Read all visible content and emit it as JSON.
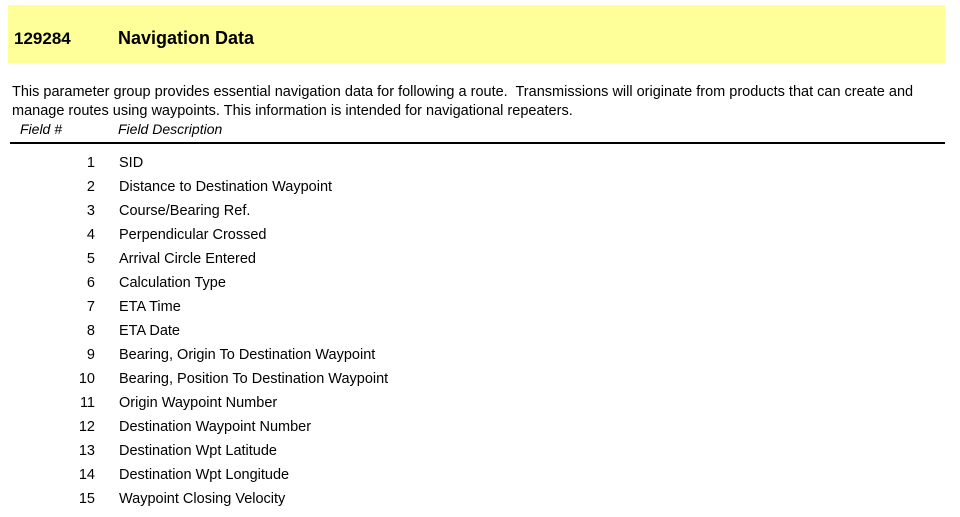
{
  "document": {
    "banner": {
      "pgn_number": "129284",
      "title": "Navigation Data",
      "background_color": "#ffff99"
    },
    "description": "This parameter group provides essential navigation data for following a route.  Transmissions will originate from products that can create and manage routes using waypoints. This information is intended for navigational repeaters.",
    "table": {
      "headers": {
        "number": "Field #",
        "description": "Field Description"
      },
      "rows": [
        {
          "num": "1",
          "desc": "SID"
        },
        {
          "num": "2",
          "desc": "Distance to Destination Waypoint"
        },
        {
          "num": "3",
          "desc": "Course/Bearing Ref."
        },
        {
          "num": "4",
          "desc": "Perpendicular Crossed"
        },
        {
          "num": "5",
          "desc": "Arrival Circle Entered"
        },
        {
          "num": "6",
          "desc": "Calculation Type"
        },
        {
          "num": "7",
          "desc": "ETA Time"
        },
        {
          "num": "8",
          "desc": "ETA Date"
        },
        {
          "num": "9",
          "desc": "Bearing, Origin To Destination Waypoint"
        },
        {
          "num": "10",
          "desc": "Bearing, Position To Destination Waypoint"
        },
        {
          "num": "11",
          "desc": "Origin Waypoint Number"
        },
        {
          "num": "12",
          "desc": "Destination Waypoint Number"
        },
        {
          "num": "13",
          "desc": "Destination Wpt Latitude"
        },
        {
          "num": "14",
          "desc": "Destination Wpt Longitude"
        },
        {
          "num": "15",
          "desc": "Waypoint Closing Velocity"
        }
      ]
    }
  }
}
